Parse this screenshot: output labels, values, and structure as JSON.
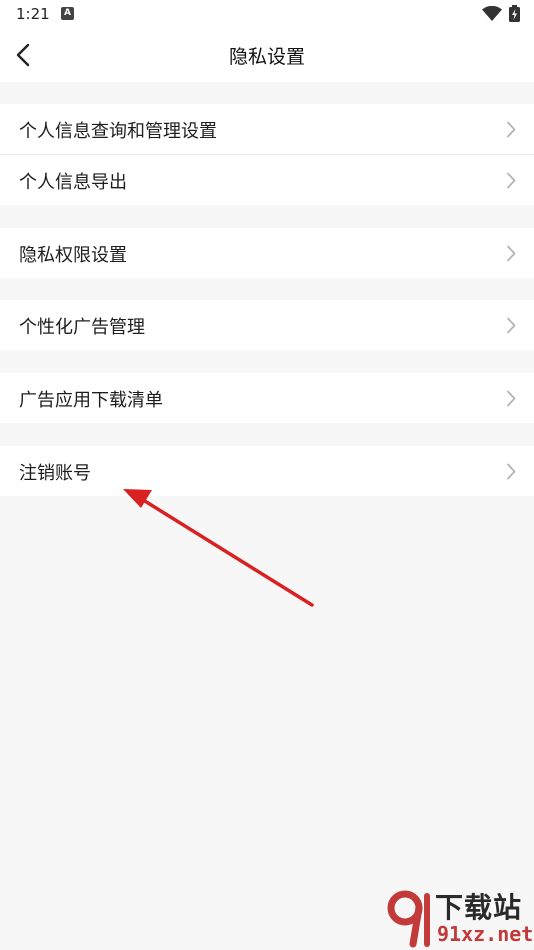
{
  "status_bar": {
    "time": "1:21",
    "notification_badge": "A"
  },
  "header": {
    "title": "隐私设置",
    "back_icon": "chevron-left-icon"
  },
  "menu": {
    "items": [
      {
        "label": "个人信息查询和管理设置"
      },
      {
        "label": "个人信息导出"
      },
      {
        "label": "隐私权限设置"
      },
      {
        "label": "个性化广告管理"
      },
      {
        "label": "广告应用下载清单"
      },
      {
        "label": "注销账号"
      }
    ],
    "chevron_icon": "chevron-right-icon"
  },
  "annotation": {
    "arrow_color": "#d92121"
  },
  "watermark": {
    "title": "下载站",
    "domain": "91xz.net",
    "accent": "#c23a3a"
  }
}
